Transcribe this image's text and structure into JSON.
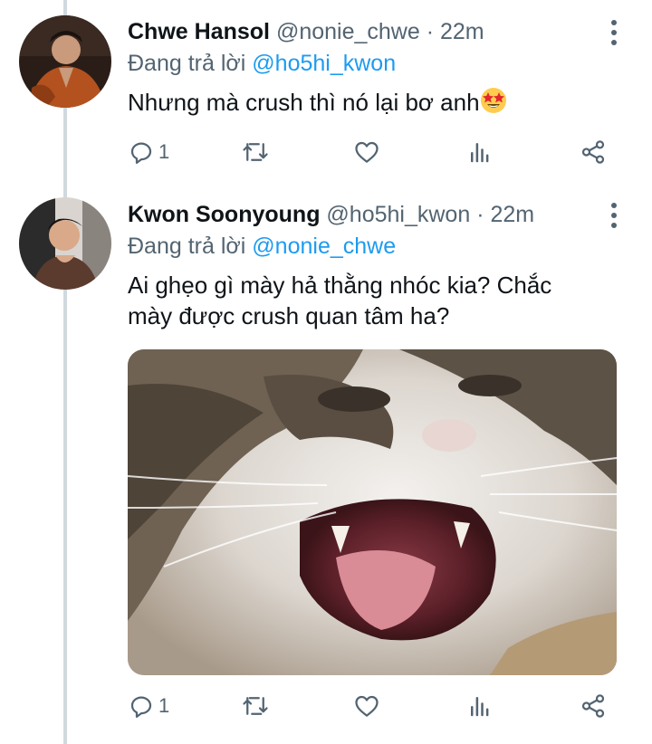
{
  "tweets": [
    {
      "name": "Chwe Hansol",
      "handle": "@nonie_chwe",
      "separator": "·",
      "time": "22m",
      "replying_prefix": "Đang trả lời",
      "replying_to": "@ho5hi_kwon",
      "text": "Nhưng mà crush thì nó lại bơ anh",
      "emoji": "star-struck",
      "actions": {
        "reply_count": "1",
        "retweet_count": "",
        "like_count": ""
      }
    },
    {
      "name": "Kwon Soonyoung",
      "handle": "@ho5hi_kwon",
      "separator": "·",
      "time": "22m",
      "replying_prefix": "Đang trả lời",
      "replying_to": "@nonie_chwe",
      "text_line1": "Ai ghẹo gì mày hả thằng nhóc kia? Chắc",
      "text_line2": "mày được crush quan tâm ha?",
      "media": "photo of a screaming tabby-and-white cat",
      "actions": {
        "reply_count": "1",
        "retweet_count": "",
        "like_count": ""
      }
    }
  ],
  "colors": {
    "text": "#0f1419",
    "secondary": "#536471",
    "link": "#1d9bf0",
    "thread_line": "#cfd9de"
  }
}
